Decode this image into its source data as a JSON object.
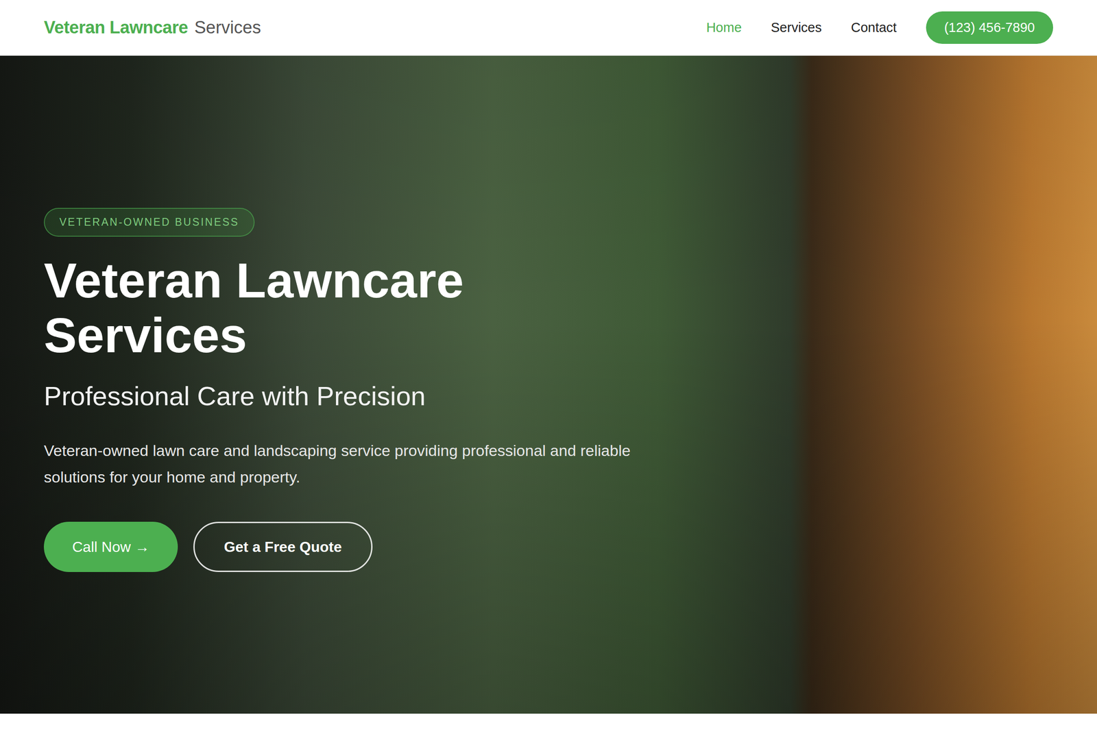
{
  "brand": {
    "main": "Veteran Lawncare",
    "sub": "Services"
  },
  "nav": [
    {
      "label": "Home",
      "selected": true
    },
    {
      "label": "Services",
      "selected": false
    },
    {
      "label": "Contact",
      "selected": false
    }
  ],
  "phone_button": "(123) 456-7890",
  "hero": {
    "badge": "VETERAN-OWNED BUSINESS",
    "title": "Veteran Lawncare Services",
    "subtitle": "Professional Care with Precision",
    "text": "Veteran-owned lawn care and landscaping service providing professional and reliable solutions for your home and property.",
    "buttons": [
      "Call Now →",
      "Get a Free Quote"
    ]
  }
}
